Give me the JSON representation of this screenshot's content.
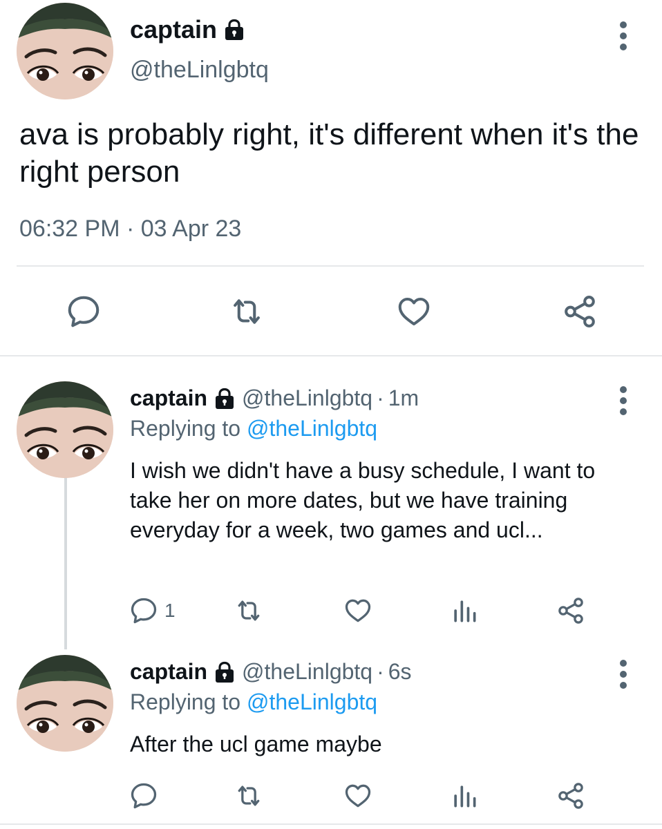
{
  "main_tweet": {
    "author_name": "captain",
    "author_handle": "@theLinlgbtq",
    "text": "ava is probably right, it's different when it's the right person",
    "timestamp": "06:32 PM",
    "separator": "·",
    "date": "03 Apr 23",
    "icons": {
      "reply": "reply-icon",
      "retweet": "retweet-icon",
      "like": "like-icon",
      "share": "share-icon"
    }
  },
  "replies": [
    {
      "author_name": "captain",
      "author_handle": "@theLinlgbtq",
      "separator": "·",
      "time": "1m",
      "replying_prefix": "Replying to",
      "replying_to": "@theLinlgbtq",
      "text": "I wish we didn't have a busy schedule, I want to take her on more dates, but we have training everyday for a week, two games and ucl...",
      "reply_count": "1"
    },
    {
      "author_name": "captain",
      "author_handle": "@theLinlgbtq",
      "separator": "·",
      "time": "6s",
      "replying_prefix": "Replying to",
      "replying_to": "@theLinlgbtq",
      "text": "After the ucl game maybe",
      "reply_count": ""
    }
  ],
  "colors": {
    "text": "#0f1419",
    "muted": "#536471",
    "link": "#1d9bf0",
    "divider": "#e6e8ea"
  }
}
